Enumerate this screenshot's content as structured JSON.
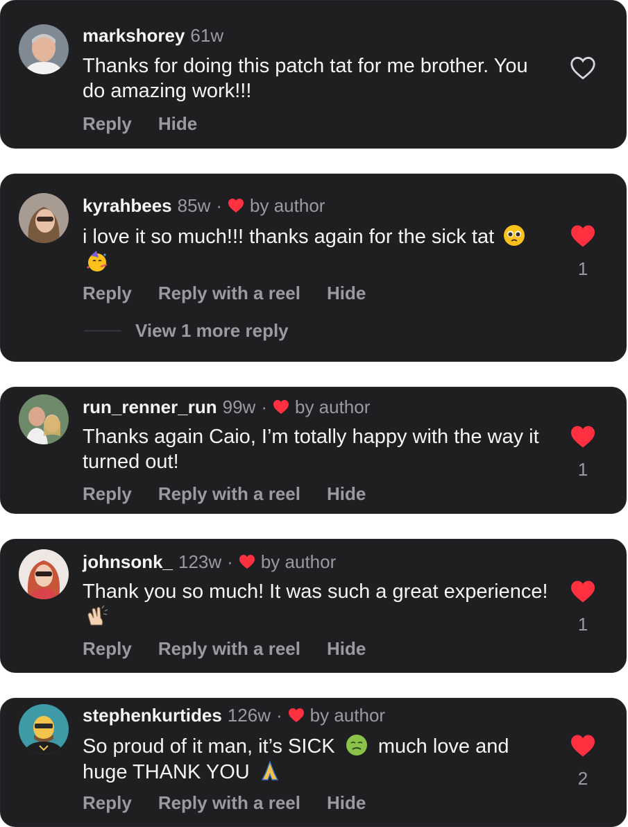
{
  "comments": [
    {
      "username": "markshorey",
      "time": "61w",
      "by_author": "",
      "text": "Thanks for doing this patch tat for me brother. You do amazing work!!!",
      "emojis": [],
      "liked": false,
      "like_count": "",
      "actions": [
        "Reply",
        "Hide"
      ],
      "view_more": ""
    },
    {
      "username": "kyrahbees",
      "time": "85w",
      "by_author": "by author",
      "text": "i love it so much!!! thanks again for the sick tat",
      "emojis": [
        "pleading-face-emoji",
        "partying-face-emoji"
      ],
      "liked": true,
      "like_count": "1",
      "actions": [
        "Reply",
        "Reply with a reel",
        "Hide"
      ],
      "view_more": "View 1 more reply"
    },
    {
      "username": "run_renner_run",
      "time": "99w",
      "by_author": "by author",
      "text": "Thanks again Caio, I’m totally happy with the way it turned out!",
      "emojis": [],
      "liked": true,
      "like_count": "1",
      "actions": [
        "Reply",
        "Reply with a reel",
        "Hide"
      ],
      "view_more": ""
    },
    {
      "username": "johnsonk_",
      "time": "123w",
      "by_author": "by author",
      "text": "Thank you so much! It was such a great experience!",
      "emojis": [
        "clapping-hands-emoji"
      ],
      "liked": true,
      "like_count": "1",
      "actions": [
        "Reply",
        "Reply with a reel",
        "Hide"
      ],
      "view_more": ""
    },
    {
      "username": "stephenkurtides",
      "time": "126w",
      "by_author": "by author",
      "text_part1": "So proud of it man, it’s SICK",
      "text_part2": "much love and huge THANK YOU",
      "emojis": [
        "nauseated-face-emoji",
        "folded-hands-emoji"
      ],
      "liked": true,
      "like_count": "2",
      "actions": [
        "Reply",
        "Reply with a reel",
        "Hide"
      ],
      "view_more": ""
    }
  ],
  "colors": {
    "card_bg": "#1f1f22",
    "text": "#f5f5f5",
    "muted": "#9a9aa1",
    "like_red": "#ff3040"
  }
}
